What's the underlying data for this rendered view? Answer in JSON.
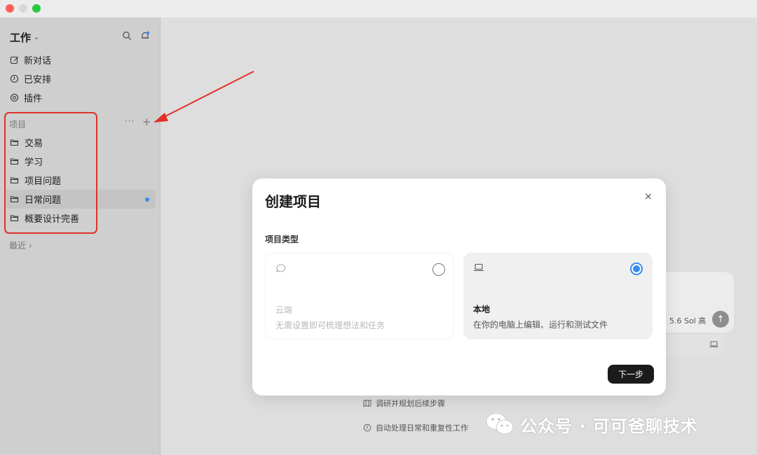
{
  "sidebar": {
    "workspace": "工作",
    "nav": [
      {
        "label": "新对话",
        "icon": "edit-icon"
      },
      {
        "label": "已安排",
        "icon": "clock-icon"
      },
      {
        "label": "插件",
        "icon": "at-icon"
      }
    ],
    "projects_label": "项目",
    "projects_more": "···",
    "projects_add": "+",
    "projects": [
      {
        "label": "交易"
      },
      {
        "label": "学习"
      },
      {
        "label": "项目问题"
      },
      {
        "label": "日常问题",
        "active": true
      },
      {
        "label": "概要设计完善"
      }
    ],
    "recent_label": "最近 ›"
  },
  "modal": {
    "title": "创建项目",
    "close": "×",
    "type_label": "项目类型",
    "options": [
      {
        "name": "云端",
        "desc": "无需设置即可梳理想法和任务",
        "icon": "cloud-chat-icon",
        "selected": false
      },
      {
        "name": "本地",
        "desc": "在你的电脑上编辑、运行和测试文件",
        "icon": "laptop-icon",
        "selected": true
      }
    ],
    "next_label": "下一步"
  },
  "composer": {
    "meta": "5.6 Sol  高",
    "send": "↑"
  },
  "suggestions": [
    {
      "label": "调研并规划后续步骤",
      "icon": "map-icon"
    },
    {
      "label": "自动处理日常和重复性工作",
      "icon": "clock-icon"
    }
  ],
  "watermark": "公众号 · 可可爸聊技术",
  "colors": {
    "accent": "#3a8cf2",
    "annotation": "#e0312b",
    "primary_button": "#1b1b1b"
  }
}
